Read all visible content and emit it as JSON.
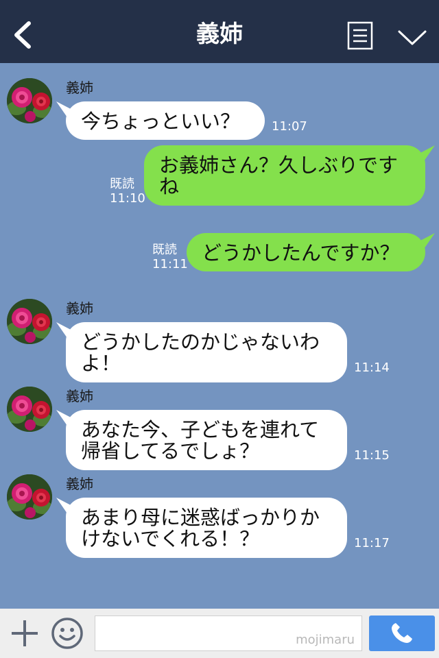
{
  "header": {
    "title": "義姉"
  },
  "messages": [
    {
      "sender": "義姉",
      "text": "今ちょっといい？",
      "time": "11:07"
    },
    {
      "read": "既読",
      "time": "11:10",
      "text": "お義姉さん？久しぶりです\nね"
    },
    {
      "read": "既読",
      "time": "11:11",
      "text": "どうかしたんですか？"
    },
    {
      "sender": "義姉",
      "text": "どうかしたのかじゃないわ\nよ！",
      "time": "11:14"
    },
    {
      "sender": "義姉",
      "text": "あなた今、子どもを連れて\n帰省してるでしょ？",
      "time": "11:15"
    },
    {
      "sender": "義姉",
      "text": "あまり母に迷惑ばっかりか\nけないでくれる！？",
      "time": "11:17"
    }
  ],
  "input": {
    "watermark": "mojimaru"
  },
  "colors": {
    "header_bg": "#243048",
    "chat_bg": "#7494c0",
    "outgoing_bubble": "#84e04c",
    "incoming_bubble": "#ffffff",
    "call_button": "#4a90e8"
  },
  "icons": [
    "back-icon",
    "menu-icon",
    "chevron-down-icon",
    "plus-icon",
    "smile-icon",
    "phone-icon",
    "rose-avatar"
  ]
}
